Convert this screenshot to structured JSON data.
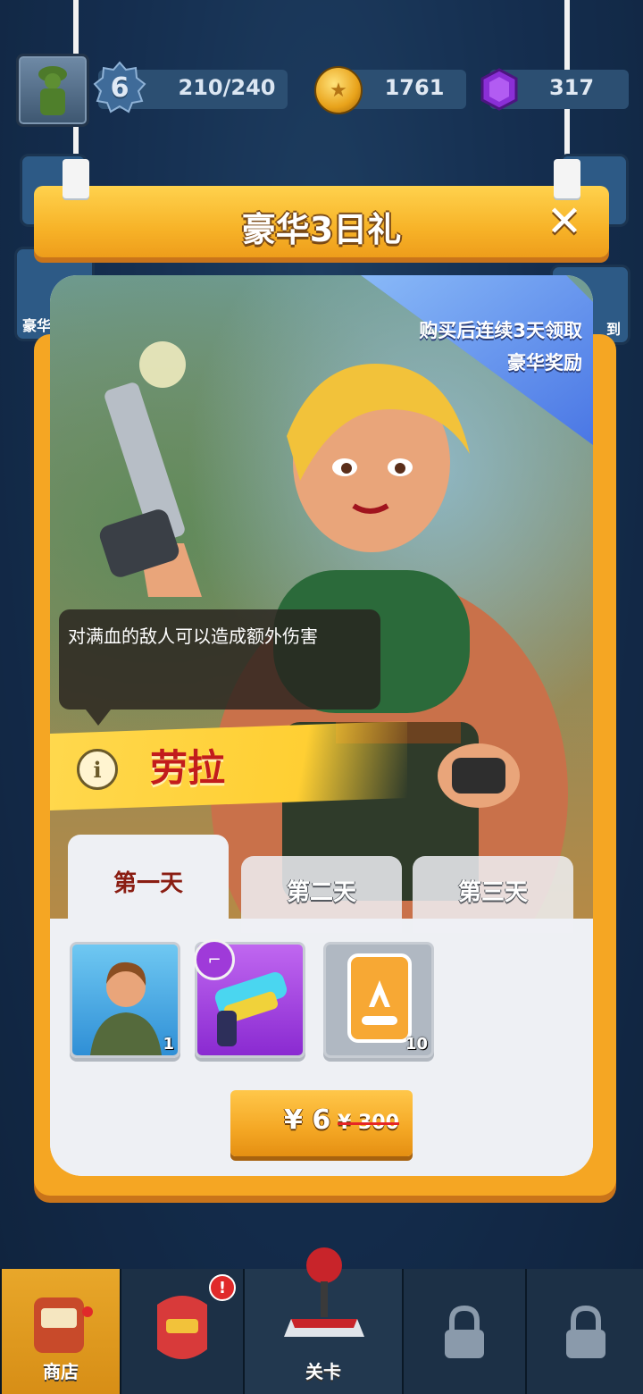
{
  "hud": {
    "level": "6",
    "xp": "210/240",
    "coins": "1761",
    "gems": "317"
  },
  "side_buttons": {
    "left_label": "豪华",
    "right_label": "到"
  },
  "popup": {
    "title": "豪华3日礼",
    "corner_line1": "购买后连续3天领取",
    "corner_line2": "豪华奖励",
    "skill_text": "对满血的敌人可以造成额外伤害",
    "hero_name": "劳拉",
    "tabs": [
      {
        "label": "第一天",
        "active": true
      },
      {
        "label": "第二天",
        "active": false
      },
      {
        "label": "第三天",
        "active": false
      }
    ],
    "items": [
      {
        "name": "hero-card",
        "count": "1"
      },
      {
        "name": "weapon",
        "count": ""
      },
      {
        "name": "hero-shard-card",
        "count": "10"
      }
    ],
    "price": "¥ 6",
    "original_price": "¥ 300"
  },
  "nav": [
    {
      "label": "商店",
      "active": true
    },
    {
      "label": "",
      "active": false,
      "alert": "!"
    },
    {
      "label": "关卡",
      "active": false
    },
    {
      "label": "",
      "active": false,
      "locked": true
    },
    {
      "label": "",
      "active": false,
      "locked": true
    }
  ],
  "colors": {
    "accent_orange": "#f5a623",
    "hero_name_red": "#c21c1c",
    "active_tab_text": "#8a1d12",
    "nav_active": "#e8a72a"
  }
}
